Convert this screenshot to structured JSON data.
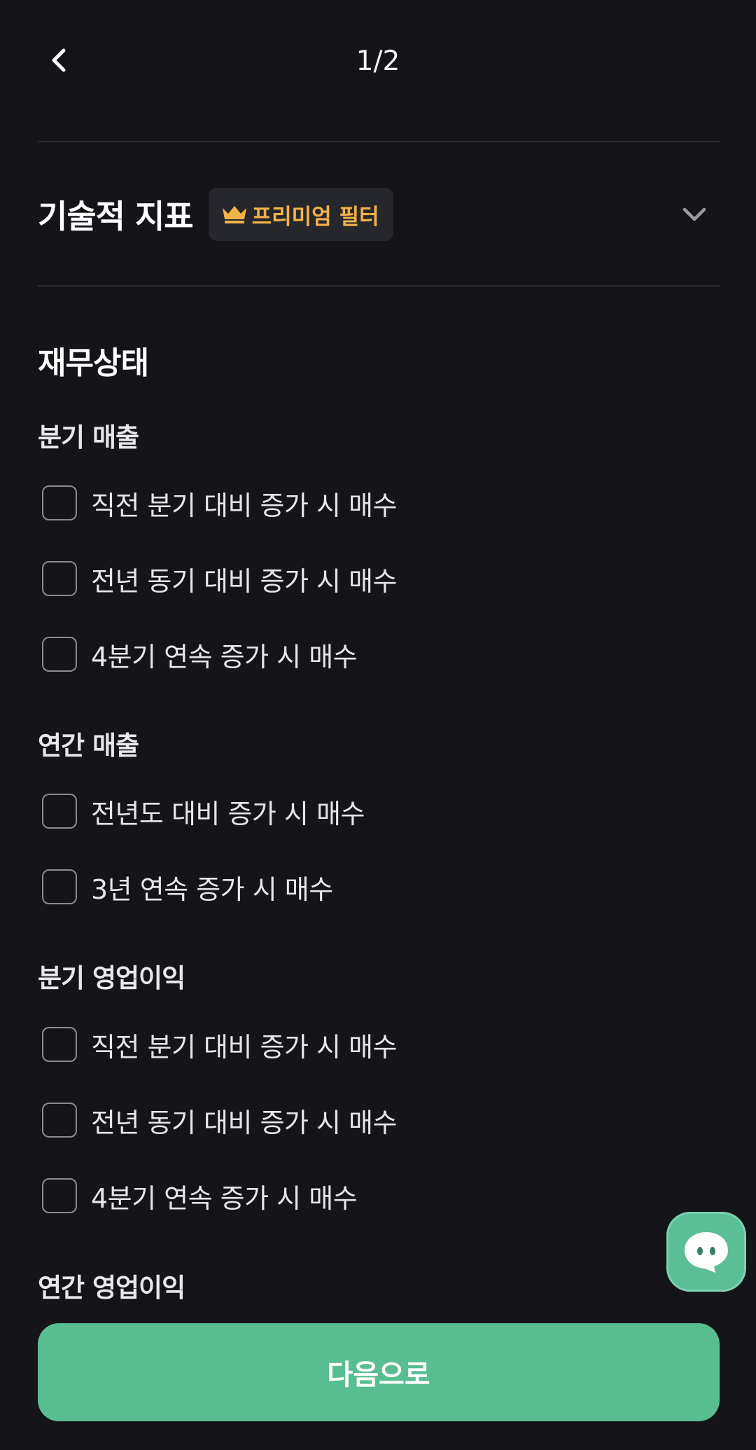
{
  "header": {
    "page_indicator": "1/2"
  },
  "technical_section": {
    "title": "기술적 지표",
    "badge_label": "프리미엄 필터",
    "badge_color": "#F2B24A"
  },
  "financial_section": {
    "title": "재무상태",
    "groups": [
      {
        "title": "분기 매출",
        "options": [
          "직전 분기 대비 증가 시 매수",
          "전년 동기 대비 증가 시 매수",
          "4분기 연속 증가 시 매수"
        ]
      },
      {
        "title": "연간 매출",
        "options": [
          "전년도 대비 증가 시 매수",
          "3년 연속 증가 시 매수"
        ]
      },
      {
        "title": "분기 영업이익",
        "options": [
          "직전 분기 대비 증가 시 매수",
          "전년 동기 대비 증가 시 매수",
          "4분기 연속 증가 시 매수"
        ]
      },
      {
        "title": "연간 영업이익",
        "options": []
      }
    ]
  },
  "footer": {
    "next_label": "다음으로",
    "accent_color": "#58BD91"
  }
}
